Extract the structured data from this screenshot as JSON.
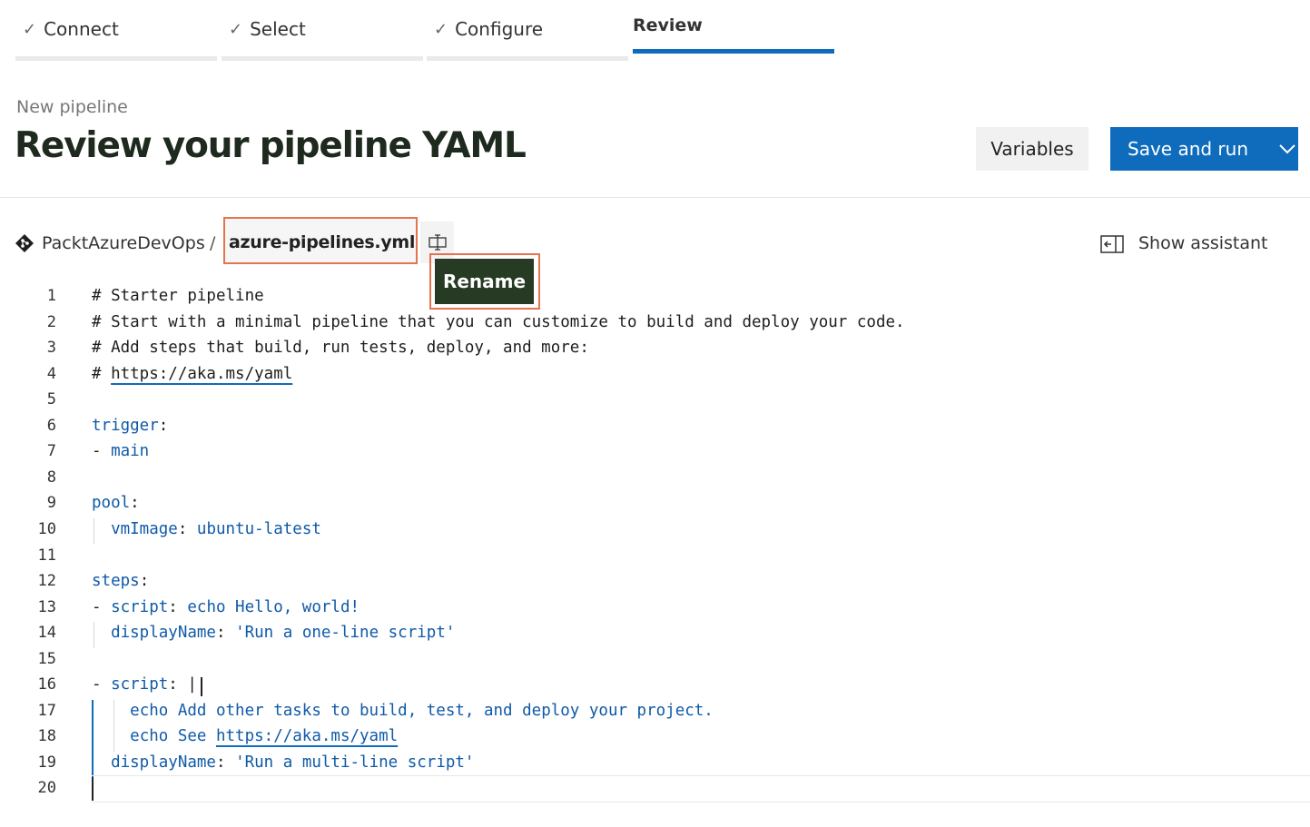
{
  "wizard": {
    "steps": [
      {
        "label": "Connect",
        "done": true
      },
      {
        "label": "Select",
        "done": true
      },
      {
        "label": "Configure",
        "done": true
      },
      {
        "label": "Review",
        "done": false,
        "active": true
      }
    ]
  },
  "header": {
    "subtitle": "New pipeline",
    "title": "Review your pipeline YAML",
    "variables_label": "Variables",
    "save_label": "Save and run"
  },
  "file": {
    "repo": "PacktAzureDevOps",
    "separator": "/",
    "filename": "azure-pipelines.yml *",
    "rename_tooltip": "Rename",
    "show_assistant": "Show assistant"
  },
  "editor": {
    "lines": [
      {
        "n": "1",
        "parts": [
          [
            "c-comment",
            "# Starter pipeline"
          ]
        ]
      },
      {
        "n": "2",
        "parts": [
          [
            "c-comment",
            "# Start with a minimal pipeline that you can customize to build and deploy your code."
          ]
        ]
      },
      {
        "n": "3",
        "parts": [
          [
            "c-comment",
            "# Add steps that build, run tests, deploy, and more:"
          ]
        ]
      },
      {
        "n": "4",
        "parts": [
          [
            "c-comment",
            "# "
          ],
          [
            "c-link",
            "https://aka.ms/yaml"
          ]
        ]
      },
      {
        "n": "5",
        "parts": []
      },
      {
        "n": "6",
        "parts": [
          [
            "c-key",
            "trigger"
          ],
          [
            "c-comment",
            ":"
          ]
        ]
      },
      {
        "n": "7",
        "parts": [
          [
            "c-comment",
            "- "
          ],
          [
            "c-val",
            "main"
          ]
        ]
      },
      {
        "n": "8",
        "parts": []
      },
      {
        "n": "9",
        "parts": [
          [
            "c-key",
            "pool"
          ],
          [
            "c-comment",
            ":"
          ]
        ]
      },
      {
        "n": "10",
        "parts": [
          [
            "c-comment",
            "  "
          ],
          [
            "c-key",
            "vmImage"
          ],
          [
            "c-comment",
            ": "
          ],
          [
            "c-val",
            "ubuntu-latest"
          ]
        ]
      },
      {
        "n": "11",
        "parts": []
      },
      {
        "n": "12",
        "parts": [
          [
            "c-key",
            "steps"
          ],
          [
            "c-comment",
            ":"
          ]
        ]
      },
      {
        "n": "13",
        "parts": [
          [
            "c-comment",
            "- "
          ],
          [
            "c-key",
            "script"
          ],
          [
            "c-comment",
            ": "
          ],
          [
            "c-val",
            "echo Hello, world!"
          ]
        ]
      },
      {
        "n": "14",
        "parts": [
          [
            "c-comment",
            "  "
          ],
          [
            "c-key",
            "displayName"
          ],
          [
            "c-comment",
            ": "
          ],
          [
            "c-str",
            "'Run a one-line script'"
          ]
        ]
      },
      {
        "n": "15",
        "parts": []
      },
      {
        "n": "16",
        "parts": [
          [
            "c-comment",
            "- "
          ],
          [
            "c-key",
            "script"
          ],
          [
            "c-comment",
            ": |"
          ]
        ]
      },
      {
        "n": "17",
        "parts": [
          [
            "c-comment",
            "    "
          ],
          [
            "c-val",
            "echo Add other tasks to build, test, and deploy your project."
          ]
        ]
      },
      {
        "n": "18",
        "parts": [
          [
            "c-comment",
            "    "
          ],
          [
            "c-val",
            "echo See "
          ],
          [
            "c-link2",
            "https://aka.ms/yaml"
          ]
        ]
      },
      {
        "n": "19",
        "parts": [
          [
            "c-comment",
            "  "
          ],
          [
            "c-key",
            "displayName"
          ],
          [
            "c-comment",
            ": "
          ],
          [
            "c-str",
            "'Run a multi-line script'"
          ]
        ]
      },
      {
        "n": "20",
        "parts": []
      }
    ]
  },
  "colors": {
    "accent": "#0f6cbd",
    "highlight_outline": "#e4734f",
    "tooltip_bg": "#273a24",
    "yaml_key": "#0f5aa8"
  },
  "icons": {
    "step_done": "checkmark-icon",
    "repo": "git-repo-icon",
    "rename": "rename-icon",
    "assistant": "show-assistant-icon",
    "save_menu": "chevron-down-icon"
  }
}
